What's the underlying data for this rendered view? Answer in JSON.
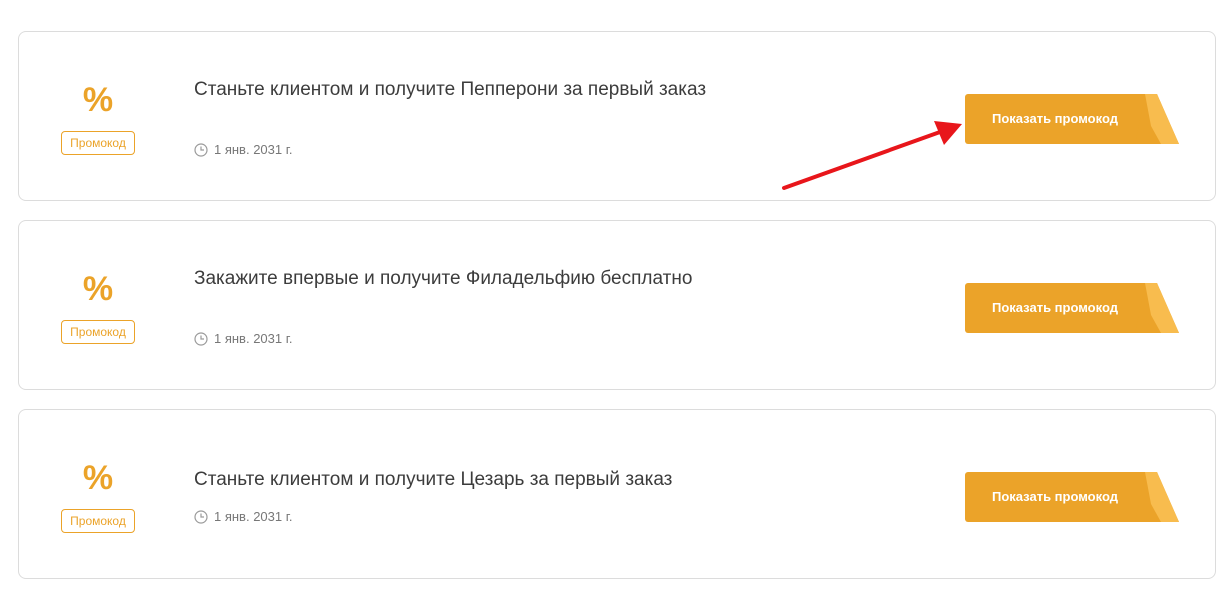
{
  "colors": {
    "accent": "#EBA329",
    "accent_light": "#F8BC4E",
    "arrow": "#E8161B"
  },
  "icons": {
    "date_icon": "clock-icon"
  },
  "offers": [
    {
      "percent_symbol": "%",
      "tag_label": "Промокод",
      "title": "Станьте клиентом и получите Пепперони за первый заказ",
      "date": "1 янв. 2031 г.",
      "button_label": "Показать промокод"
    },
    {
      "percent_symbol": "%",
      "tag_label": "Промокод",
      "title": "Закажите впервые и получите Филадельфию бесплатно",
      "date": "1 янв. 2031 г.",
      "button_label": "Показать промокод"
    },
    {
      "percent_symbol": "%",
      "tag_label": "Промокод",
      "title": "Станьте клиентом и получите Цезарь за первый заказ",
      "date": "1 янв. 2031 г.",
      "button_label": "Показать промокод"
    }
  ]
}
